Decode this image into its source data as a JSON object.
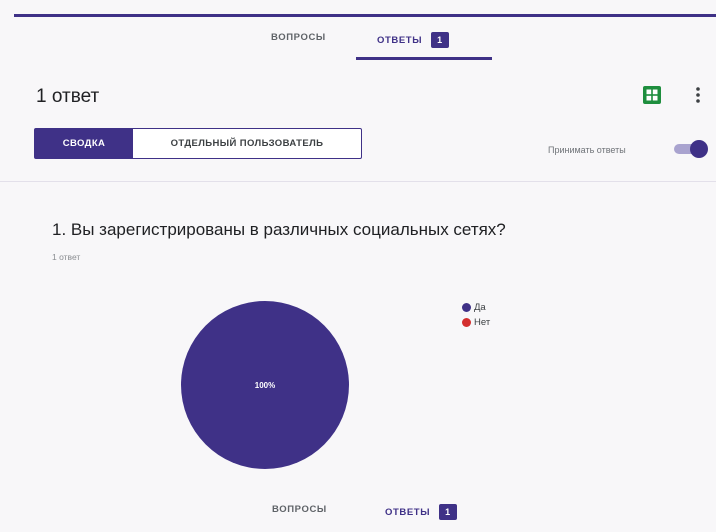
{
  "tabs": [
    {
      "label": "ВОПРОСЫ",
      "active": false
    },
    {
      "label": "ОТВЕТЫ",
      "active": true,
      "badge": "1"
    }
  ],
  "header": {
    "response_count": "1 ответ",
    "sheets_icon": "spreadsheet-icon",
    "more_icon": "more-vertical-icon"
  },
  "view_toggle": {
    "summary_label": "СВОДКА",
    "individual_label": "ОТДЕЛЬНЫЙ ПОЛЬЗОВАТЕЛЬ"
  },
  "accepting": {
    "label": "Принимать ответы",
    "enabled": true
  },
  "question": {
    "title": "1. Вы зарегистрированы в различных социальных сетях?",
    "subtitle": "1 ответ",
    "slice_label": "100%",
    "legend": [
      {
        "label": "Да",
        "color": "#3f3187"
      },
      {
        "label": "Нет",
        "color": "#d32f2f"
      }
    ]
  },
  "chart_data": {
    "type": "pie",
    "categories": [
      "Да",
      "Нет"
    ],
    "values": [
      100,
      0
    ],
    "colors": [
      "#3f3187",
      "#d32f2f"
    ],
    "legend": "right"
  },
  "bottom_tabs": [
    {
      "label": "ВОПРОСЫ",
      "active": false
    },
    {
      "label": "ОТВЕТЫ",
      "active": true,
      "badge": "1"
    }
  ],
  "colors": {
    "accent": "#3f3187",
    "sheets_green": "#1e8e3e",
    "no_red": "#d32f2f"
  }
}
